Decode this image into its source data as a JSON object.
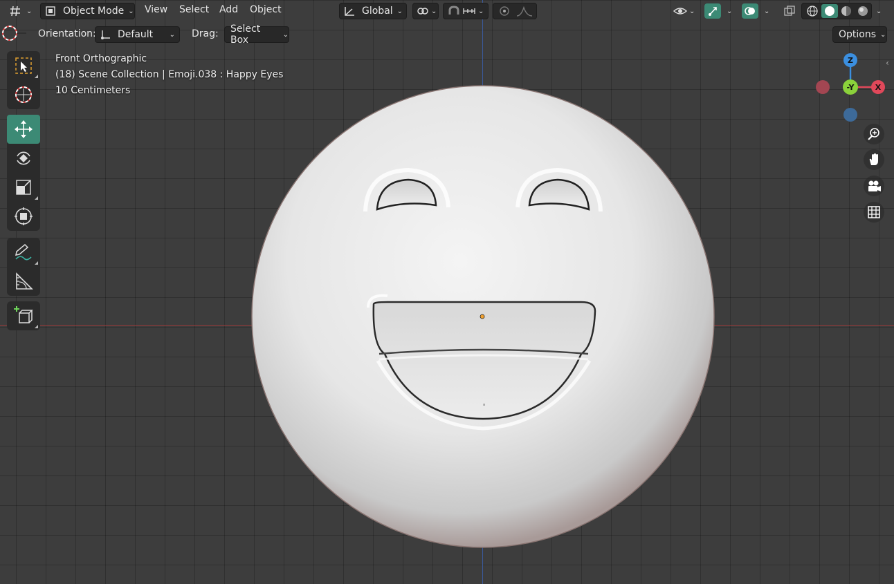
{
  "header": {
    "mode": "Object Mode",
    "menus": [
      "View",
      "Select",
      "Add",
      "Object"
    ],
    "transform_orientation": "Global",
    "options_label": "Options"
  },
  "tool_settings": {
    "orientation_label": "Orientation:",
    "orientation_value": "Default",
    "drag_label": "Drag:",
    "drag_value": "Select Box"
  },
  "viewport_info": {
    "view_name": "Front Orthographic",
    "collection_line": "(18) Scene Collection | Emoji.038 : Happy Eyes",
    "scale_line": "10 Centimeters"
  },
  "gizmo": {
    "z": "Z",
    "y": "-Y",
    "x": "X"
  },
  "toolbar": {
    "tools": [
      "select-box-tool",
      "cursor-tool",
      "move-tool",
      "rotate-tool",
      "scale-tool",
      "transform-tool",
      "annotate-tool",
      "measure-tool",
      "add-cube-tool"
    ],
    "active": "move-tool"
  },
  "colors": {
    "accent": "#3c8a75",
    "axis_x": "#9b3a3a",
    "axis_z": "#3a5a9b",
    "gizmo_x": "#e0485a",
    "gizmo_y": "#8bd13b",
    "gizmo_z": "#3b8fe0"
  }
}
